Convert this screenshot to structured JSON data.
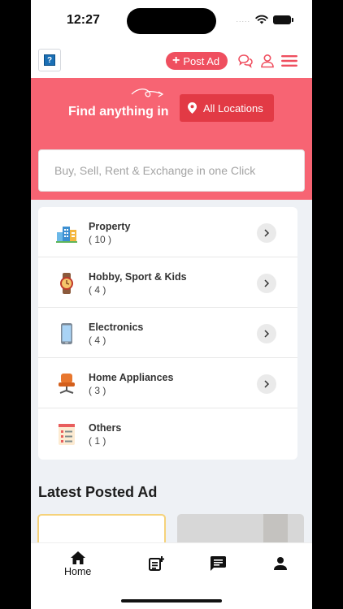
{
  "status_bar": {
    "time": "12:27",
    "signal": "....."
  },
  "header": {
    "logo_glyph": "?",
    "post_ad_icon": "plus-icon",
    "post_ad_label": "Post Ad",
    "icons": [
      "chat-icon",
      "user-icon",
      "menu-icon"
    ]
  },
  "hero": {
    "find_text": "Find anything in",
    "location_label": "All Locations",
    "search_placeholder": "Buy, Sell, Rent & Exchange in one Click"
  },
  "categories": [
    {
      "name": "Property",
      "count": "( 10 )",
      "icon": "buildings-icon"
    },
    {
      "name": "Hobby, Sport & Kids",
      "count": "( 4 )",
      "icon": "watch-icon"
    },
    {
      "name": "Electronics",
      "count": "( 4 )",
      "icon": "phone-icon"
    },
    {
      "name": "Home Appliances",
      "count": "( 3 )",
      "icon": "chair-icon"
    },
    {
      "name": "Others",
      "count": "( 1 )",
      "icon": "document-icon"
    }
  ],
  "latest_title": "Latest Posted Ad",
  "bottom_nav": {
    "home_label": "Home",
    "icons": [
      "home-icon",
      "post-ad-icon",
      "chat-icon",
      "account-icon"
    ]
  },
  "colors": {
    "brand": "#ef4f5f",
    "hero_bg": "#f76473",
    "location_btn": "#e23a45"
  }
}
